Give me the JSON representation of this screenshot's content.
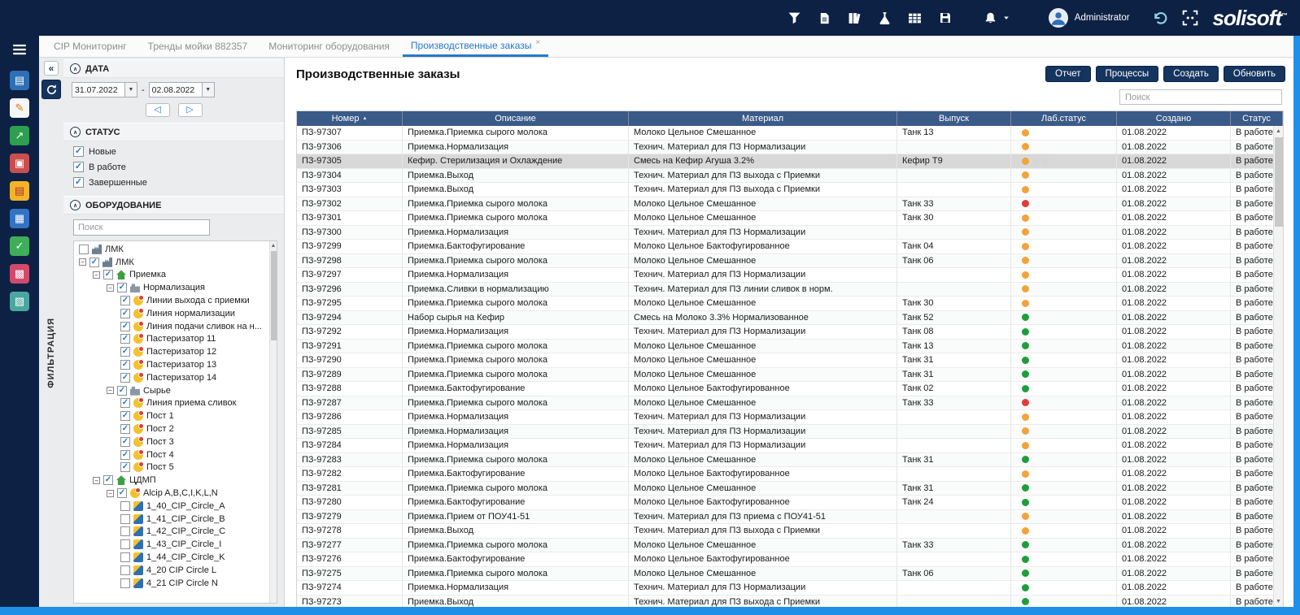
{
  "window": {
    "accent_color": "#1f8fe8",
    "navy": "#0d2145"
  },
  "topbar": {
    "tool_icons": [
      "filter",
      "document",
      "library",
      "flask",
      "spreadsheet",
      "save"
    ],
    "bell_icon": "bell",
    "user": "Administrator",
    "logo": "solisoft",
    "logo_suffix": "™"
  },
  "sidebar": {
    "menu_icon": "menu",
    "app_icons": [
      "reports",
      "signature",
      "trends",
      "alarms",
      "orders",
      "spreadsheet-app",
      "tasks",
      "dashboard",
      "images"
    ]
  },
  "tabs": [
    {
      "label": "CIP Мониторинг",
      "active": false
    },
    {
      "label": "Тренды мойки 882357",
      "active": false
    },
    {
      "label": "Мониторинг оборудования",
      "active": false
    },
    {
      "label": "Производственные заказы",
      "active": true,
      "closable": true
    }
  ],
  "filter": {
    "rail_label": "ФИЛЬТРАЦИЯ",
    "date": {
      "title": "ДАТА",
      "from": "31.07.2022",
      "to": "02.08.2022",
      "separator": "-"
    },
    "status": {
      "title": "СТАТУС",
      "options": [
        {
          "label": "Новые",
          "checked": true
        },
        {
          "label": "В работе",
          "checked": true
        },
        {
          "label": "Завершенные",
          "checked": true
        }
      ]
    },
    "equipment": {
      "title": "ОБОРУДОВАНИЕ",
      "search_placeholder": "Поиск",
      "tree": [
        {
          "label": "ЛМК",
          "depth": 0,
          "checked": false,
          "icon": "factory",
          "expand": false
        },
        {
          "label": "ЛМК",
          "depth": 0,
          "checked": true,
          "icon": "factory",
          "expand": true
        },
        {
          "label": "Приемка",
          "depth": 1,
          "checked": true,
          "icon": "home",
          "expand": true
        },
        {
          "label": "Нормализация",
          "depth": 2,
          "checked": true,
          "icon": "unit",
          "expand": true
        },
        {
          "label": "Линии выхода с приемки",
          "depth": 3,
          "checked": true,
          "icon": "line",
          "expand": false
        },
        {
          "label": "Линия нормализации",
          "depth": 3,
          "checked": true,
          "icon": "line",
          "expand": false
        },
        {
          "label": "Линия подачи сливок на н...",
          "depth": 3,
          "checked": true,
          "icon": "line",
          "expand": false
        },
        {
          "label": "Пастеризатор 11",
          "depth": 3,
          "checked": true,
          "icon": "line",
          "expand": false
        },
        {
          "label": "Пастеризатор 12",
          "depth": 3,
          "checked": true,
          "icon": "line",
          "expand": false
        },
        {
          "label": "Пастеризатор 13",
          "depth": 3,
          "checked": true,
          "icon": "line",
          "expand": false
        },
        {
          "label": "Пастеризатор 14",
          "depth": 3,
          "checked": true,
          "icon": "line",
          "expand": false
        },
        {
          "label": "Сырье",
          "depth": 2,
          "checked": true,
          "icon": "unit",
          "expand": true
        },
        {
          "label": "Линия приема сливок",
          "depth": 3,
          "checked": true,
          "icon": "line",
          "expand": false
        },
        {
          "label": "Пост 1",
          "depth": 3,
          "checked": true,
          "icon": "line",
          "expand": false
        },
        {
          "label": "Пост 2",
          "depth": 3,
          "checked": true,
          "icon": "line",
          "expand": false
        },
        {
          "label": "Пост 3",
          "depth": 3,
          "checked": true,
          "icon": "line",
          "expand": false
        },
        {
          "label": "Пост 4",
          "depth": 3,
          "checked": true,
          "icon": "line",
          "expand": false
        },
        {
          "label": "Пост 5",
          "depth": 3,
          "checked": true,
          "icon": "line",
          "expand": false
        },
        {
          "label": "ЦДМП",
          "depth": 1,
          "checked": true,
          "icon": "home",
          "expand": true
        },
        {
          "label": "Alcip A,B,C,I,K,L,N",
          "depth": 2,
          "checked": true,
          "icon": "line",
          "expand": true
        },
        {
          "label": "1_40_CIP_Circle_A",
          "depth": 3,
          "checked": false,
          "icon": "cip",
          "expand": false
        },
        {
          "label": "1_41_CIP_Circle_B",
          "depth": 3,
          "checked": false,
          "icon": "cip",
          "expand": false
        },
        {
          "label": "1_42_CIP_Circle_C",
          "depth": 3,
          "checked": false,
          "icon": "cip",
          "expand": false
        },
        {
          "label": "1_43_CIP_Circle_I",
          "depth": 3,
          "checked": false,
          "icon": "cip",
          "expand": false
        },
        {
          "label": "1_44_CIP_Circle_K",
          "depth": 3,
          "checked": false,
          "icon": "cip",
          "expand": false
        },
        {
          "label": "4_20 CIP Circle L",
          "depth": 3,
          "checked": false,
          "icon": "cip",
          "expand": false
        },
        {
          "label": "4_21 CIP Circle N",
          "depth": 3,
          "checked": false,
          "icon": "cip",
          "expand": false
        }
      ]
    }
  },
  "main": {
    "title": "Производственные заказы",
    "buttons": [
      "Отчет",
      "Процессы",
      "Создать",
      "Обновить"
    ],
    "search_placeholder": "Поиск",
    "table": {
      "columns": [
        "Номер",
        "Описание",
        "Материал",
        "Выпуск",
        "Лаб.статус",
        "Создано",
        "Статус"
      ],
      "status_colors": {
        "orange": "#f2a33c",
        "red": "#e23b3b",
        "green": "#1f9d3a",
        "gray": "#d6d6d6"
      },
      "rows": [
        {
          "num": "ПЗ-97307",
          "desc": "Приемка.Приемка сырого молока",
          "mat": "Молоко Цельное Смешанное",
          "rel": "Танк 13",
          "lab": [
            "orange"
          ],
          "created": "01.08.2022",
          "status": "В работе"
        },
        {
          "num": "ПЗ-97306",
          "desc": "Приемка.Нормализация",
          "mat": "Технич. Материал для ПЗ Нормализации",
          "rel": "",
          "lab": [
            "orange"
          ],
          "created": "01.08.2022",
          "status": "В работе"
        },
        {
          "num": "ПЗ-97305",
          "desc": "Кефир. Стерилизация и Охлаждение",
          "mat": "Смесь на Кефир Агуша 3.2%",
          "rel": "Кефир Т9",
          "lab": [
            "orange",
            "gray",
            "gray"
          ],
          "created": "01.08.2022",
          "status": "В работе",
          "selected": true
        },
        {
          "num": "ПЗ-97304",
          "desc": "Приемка.Выход",
          "mat": "Технич. Материал для ПЗ выхода с Приемки",
          "rel": "",
          "lab": [
            "orange"
          ],
          "created": "01.08.2022",
          "status": "В работе"
        },
        {
          "num": "ПЗ-97303",
          "desc": "Приемка.Выход",
          "mat": "Технич. Материал для ПЗ выхода с Приемки",
          "rel": "",
          "lab": [
            "orange"
          ],
          "created": "01.08.2022",
          "status": "В работе"
        },
        {
          "num": "ПЗ-97302",
          "desc": "Приемка.Приемка сырого молока",
          "mat": "Молоко Цельное Смешанное",
          "rel": "Танк 33",
          "lab": [
            "red"
          ],
          "created": "01.08.2022",
          "status": "В работе"
        },
        {
          "num": "ПЗ-97301",
          "desc": "Приемка.Приемка сырого молока",
          "mat": "Молоко Цельное Смешанное",
          "rel": "Танк 30",
          "lab": [
            "orange"
          ],
          "created": "01.08.2022",
          "status": "В работе"
        },
        {
          "num": "ПЗ-97300",
          "desc": "Приемка.Нормализация",
          "mat": "Технич. Материал для ПЗ Нормализации",
          "rel": "",
          "lab": [
            "orange"
          ],
          "created": "01.08.2022",
          "status": "В работе"
        },
        {
          "num": "ПЗ-97299",
          "desc": "Приемка.Бактофугирование",
          "mat": "Молоко Цельное Бактофугированное",
          "rel": "Танк 04",
          "lab": [
            "orange"
          ],
          "created": "01.08.2022",
          "status": "В работе"
        },
        {
          "num": "ПЗ-97298",
          "desc": "Приемка.Приемка сырого молока",
          "mat": "Молоко Цельное Смешанное",
          "rel": "Танк 06",
          "lab": [
            "orange"
          ],
          "created": "01.08.2022",
          "status": "В работе"
        },
        {
          "num": "ПЗ-97297",
          "desc": "Приемка.Нормализация",
          "mat": "Технич. Материал для ПЗ Нормализации",
          "rel": "",
          "lab": [
            "orange"
          ],
          "created": "01.08.2022",
          "status": "В работе"
        },
        {
          "num": "ПЗ-97296",
          "desc": "Приемка.Сливки в нормализацию",
          "mat": "Технич. Материал для ПЗ линии сливок в норм.",
          "rel": "",
          "lab": [
            "orange"
          ],
          "created": "01.08.2022",
          "status": "В работе"
        },
        {
          "num": "ПЗ-97295",
          "desc": "Приемка.Приемка сырого молока",
          "mat": "Молоко Цельное Смешанное",
          "rel": "Танк 30",
          "lab": [
            "orange"
          ],
          "created": "01.08.2022",
          "status": "В работе"
        },
        {
          "num": "ПЗ-97294",
          "desc": "Набор сырья на Кефир",
          "mat": "Смесь на Молоко 3.3% Нормализованное",
          "rel": "Танк 52",
          "lab": [
            "green"
          ],
          "created": "01.08.2022",
          "status": "В работе"
        },
        {
          "num": "ПЗ-97292",
          "desc": "Приемка.Нормализация",
          "mat": "Технич. Материал для ПЗ Нормализации",
          "rel": "Танк 08",
          "lab": [
            "green"
          ],
          "created": "01.08.2022",
          "status": "В работе"
        },
        {
          "num": "ПЗ-97291",
          "desc": "Приемка.Приемка сырого молока",
          "mat": "Молоко Цельное Смешанное",
          "rel": "Танк 13",
          "lab": [
            "green"
          ],
          "created": "01.08.2022",
          "status": "В работе"
        },
        {
          "num": "ПЗ-97290",
          "desc": "Приемка.Приемка сырого молока",
          "mat": "Молоко Цельное Смешанное",
          "rel": "Танк 31",
          "lab": [
            "green"
          ],
          "created": "01.08.2022",
          "status": "В работе"
        },
        {
          "num": "ПЗ-97289",
          "desc": "Приемка.Приемка сырого молока",
          "mat": "Молоко Цельное Смешанное",
          "rel": "Танк 31",
          "lab": [
            "green"
          ],
          "created": "01.08.2022",
          "status": "В работе"
        },
        {
          "num": "ПЗ-97288",
          "desc": "Приемка.Бактофугирование",
          "mat": "Молоко Цельное Бактофугированное",
          "rel": "Танк 02",
          "lab": [
            "green"
          ],
          "created": "01.08.2022",
          "status": "В работе"
        },
        {
          "num": "ПЗ-97287",
          "desc": "Приемка.Приемка сырого молока",
          "mat": "Молоко Цельное Смешанное",
          "rel": "Танк 33",
          "lab": [
            "red"
          ],
          "created": "01.08.2022",
          "status": "В работе"
        },
        {
          "num": "ПЗ-97286",
          "desc": "Приемка.Нормализация",
          "mat": "Технич. Материал для ПЗ Нормализации",
          "rel": "",
          "lab": [
            "orange"
          ],
          "created": "01.08.2022",
          "status": "В работе"
        },
        {
          "num": "ПЗ-97285",
          "desc": "Приемка.Нормализация",
          "mat": "Технич. Материал для ПЗ Нормализации",
          "rel": "",
          "lab": [
            "orange"
          ],
          "created": "01.08.2022",
          "status": "В работе"
        },
        {
          "num": "ПЗ-97284",
          "desc": "Приемка.Нормализация",
          "mat": "Технич. Материал для ПЗ Нормализации",
          "rel": "",
          "lab": [
            "orange"
          ],
          "created": "01.08.2022",
          "status": "В работе"
        },
        {
          "num": "ПЗ-97283",
          "desc": "Приемка.Приемка сырого молока",
          "mat": "Молоко Цельное Смешанное",
          "rel": "Танк 31",
          "lab": [
            "green"
          ],
          "created": "01.08.2022",
          "status": "В работе"
        },
        {
          "num": "ПЗ-97282",
          "desc": "Приемка.Бактофугирование",
          "mat": "Молоко Цельное Бактофугированное",
          "rel": "",
          "lab": [
            "orange"
          ],
          "created": "01.08.2022",
          "status": "В работе"
        },
        {
          "num": "ПЗ-97281",
          "desc": "Приемка.Приемка сырого молока",
          "mat": "Молоко Цельное Смешанное",
          "rel": "Танк 31",
          "lab": [
            "green"
          ],
          "created": "01.08.2022",
          "status": "В работе"
        },
        {
          "num": "ПЗ-97280",
          "desc": "Приемка.Бактофугирование",
          "mat": "Молоко Цельное Бактофугированное",
          "rel": "Танк 24",
          "lab": [
            "green"
          ],
          "created": "01.08.2022",
          "status": "В работе"
        },
        {
          "num": "ПЗ-97279",
          "desc": "Приемка.Прием от ПОУ41-51",
          "mat": "Технич. Материал для ПЗ приема с ПОУ41-51",
          "rel": "",
          "lab": [
            "orange"
          ],
          "created": "01.08.2022",
          "status": "В работе"
        },
        {
          "num": "ПЗ-97278",
          "desc": "Приемка.Выход",
          "mat": "Технич. Материал для ПЗ выхода с Приемки",
          "rel": "",
          "lab": [
            "orange"
          ],
          "created": "01.08.2022",
          "status": "В работе"
        },
        {
          "num": "ПЗ-97277",
          "desc": "Приемка.Приемка сырого молока",
          "mat": "Молоко Цельное Смешанное",
          "rel": "Танк 33",
          "lab": [
            "green"
          ],
          "created": "01.08.2022",
          "status": "В работе"
        },
        {
          "num": "ПЗ-97276",
          "desc": "Приемка.Бактофугирование",
          "mat": "Молоко Цельное Бактофугированное",
          "rel": "",
          "lab": [
            "green"
          ],
          "created": "01.08.2022",
          "status": "В работе"
        },
        {
          "num": "ПЗ-97275",
          "desc": "Приемка.Приемка сырого молока",
          "mat": "Молоко Цельное Смешанное",
          "rel": "Танк 06",
          "lab": [
            "green"
          ],
          "created": "01.08.2022",
          "status": "В работе"
        },
        {
          "num": "ПЗ-97274",
          "desc": "Приемка.Нормализация",
          "mat": "Технич. Материал для ПЗ Нормализации",
          "rel": "",
          "lab": [
            "green"
          ],
          "created": "01.08.2022",
          "status": "В работе"
        },
        {
          "num": "ПЗ-97273",
          "desc": "Приемка.Выход",
          "mat": "Технич. Материал для ПЗ выхода с Приемки",
          "rel": "",
          "lab": [
            "green"
          ],
          "created": "01.08.2022",
          "status": "В работе"
        }
      ]
    }
  }
}
